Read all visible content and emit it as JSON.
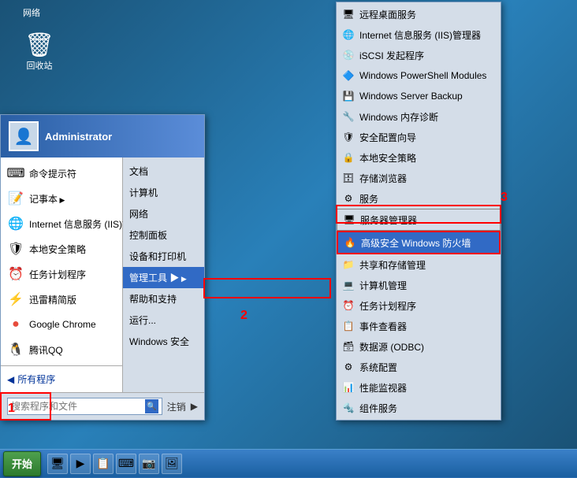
{
  "desktop": {
    "network_label": "网络",
    "recycle_bin_label": "回收站"
  },
  "start_menu": {
    "username": "Administrator",
    "left_items": [
      {
        "icon": "⌨",
        "label": "命令提示符",
        "has_arrow": false
      },
      {
        "icon": "📝",
        "label": "记事本",
        "has_arrow": true
      },
      {
        "icon": "🌐",
        "label": "Internet 信息服务 (IIS)管理器",
        "has_arrow": false
      },
      {
        "icon": "🛡",
        "label": "本地安全策略",
        "has_arrow": false
      },
      {
        "icon": "⏰",
        "label": "任务计划程序",
        "has_arrow": false
      },
      {
        "icon": "⚡",
        "label": "迅雷精简版",
        "has_arrow": false
      },
      {
        "icon": "🌐",
        "label": "Google Chrome",
        "has_arrow": false
      },
      {
        "icon": "🐧",
        "label": "腾讯QQ",
        "has_arrow": false
      }
    ],
    "right_items": [
      {
        "label": "文档"
      },
      {
        "label": "计算机"
      },
      {
        "label": "网络"
      },
      {
        "label": "控制面板"
      },
      {
        "label": "设备和打印机"
      },
      {
        "label": "管理工具",
        "highlighted": true,
        "has_arrow": true
      },
      {
        "label": "帮助和支持"
      },
      {
        "label": "运行..."
      },
      {
        "label": "Windows 安全"
      }
    ],
    "search_placeholder": "搜索程序和文件",
    "all_programs": "所有程序",
    "logout_label": "注销",
    "bottom_arrow": "▶"
  },
  "submenu": {
    "items": [
      {
        "label": "远程桌面服务"
      },
      {
        "label": "Internet 信息服务 (IIS)管理器"
      },
      {
        "label": "iSCSI 发起程序"
      },
      {
        "label": "Windows PowerShell Modules"
      },
      {
        "label": "Windows Server Backup"
      },
      {
        "label": "Windows 内存诊断"
      },
      {
        "label": "安全配置向导"
      },
      {
        "label": "本地安全策略"
      },
      {
        "label": "存储浏览器"
      },
      {
        "label": "服务"
      },
      {
        "label": "服务器管理器"
      },
      {
        "label": "高级安全 Windows 防火墙",
        "highlighted": true
      },
      {
        "label": "共享和存储管理"
      },
      {
        "label": "计算机管理"
      },
      {
        "label": "任务计划程序"
      },
      {
        "label": "事件查看器"
      },
      {
        "label": "数据源 (ODBC)"
      },
      {
        "label": "系统配置"
      },
      {
        "label": "性能监视器"
      },
      {
        "label": "组件服务"
      }
    ]
  },
  "numbers": {
    "n1": "1",
    "n2": "2",
    "n3": "3"
  },
  "taskbar": {
    "start_label": "开始"
  }
}
